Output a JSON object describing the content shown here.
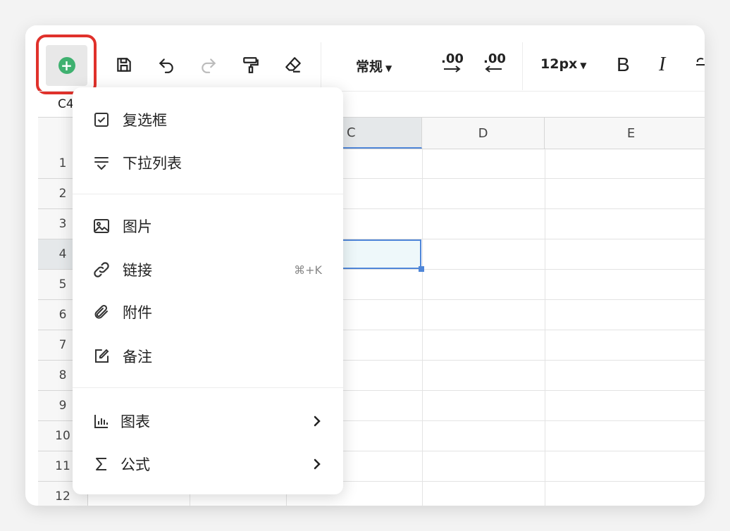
{
  "toolbar": {
    "add_symbol": "+",
    "format_label": "常规",
    "decimal_increase_label": ".00",
    "decimal_decrease_label": ".00",
    "font_size_label": "12px",
    "bold_label": "B",
    "italic_label": "I"
  },
  "formula_bar": {
    "cell_ref": "C4"
  },
  "grid": {
    "columns": [
      "C",
      "D",
      "E"
    ],
    "rows": [
      "1",
      "2",
      "3",
      "4",
      "5",
      "6",
      "7",
      "8",
      "9",
      "10",
      "11",
      "12"
    ],
    "active_column": "C",
    "active_row": "4"
  },
  "menu": {
    "items": [
      {
        "label": "复选框",
        "icon": "checkbox-icon"
      },
      {
        "label": "下拉列表",
        "icon": "dropdown-list-icon"
      },
      {
        "label": "图片",
        "icon": "image-icon"
      },
      {
        "label": "链接",
        "icon": "link-icon",
        "shortcut": "⌘+K"
      },
      {
        "label": "附件",
        "icon": "paperclip-icon"
      },
      {
        "label": "备注",
        "icon": "note-icon"
      },
      {
        "label": "图表",
        "icon": "chart-icon",
        "has_submenu": true
      },
      {
        "label": "公式",
        "icon": "sigma-icon",
        "has_submenu": true
      }
    ]
  },
  "colors": {
    "accent_blue": "#4f86d8",
    "add_green": "#3fb170",
    "highlight_red": "#e0312b",
    "selected_fill": "#eef8fa"
  }
}
